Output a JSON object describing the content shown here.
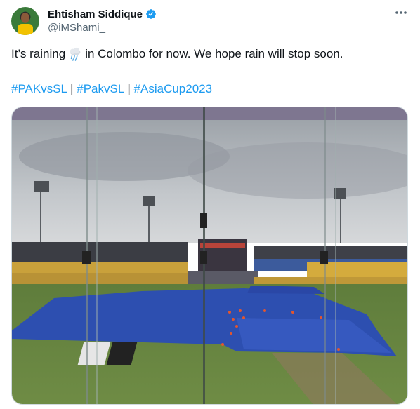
{
  "tweet": {
    "author_name": "Ehtisham Siddique",
    "handle": "@iMShami_",
    "text_before_emoji": "It’s raining",
    "emoji": "rain-cloud-icon",
    "text_after_emoji": "in Colombo for now. We hope rain will stop soon.",
    "hashtags": [
      "#PAKvsSL",
      "#PakvSL",
      "#AsiaCup2023"
    ],
    "separator": "|"
  },
  "colors": {
    "link": "#1d9bf0",
    "text": "#0f1419",
    "secondary": "#536471",
    "verified": "#1d9bf0"
  }
}
